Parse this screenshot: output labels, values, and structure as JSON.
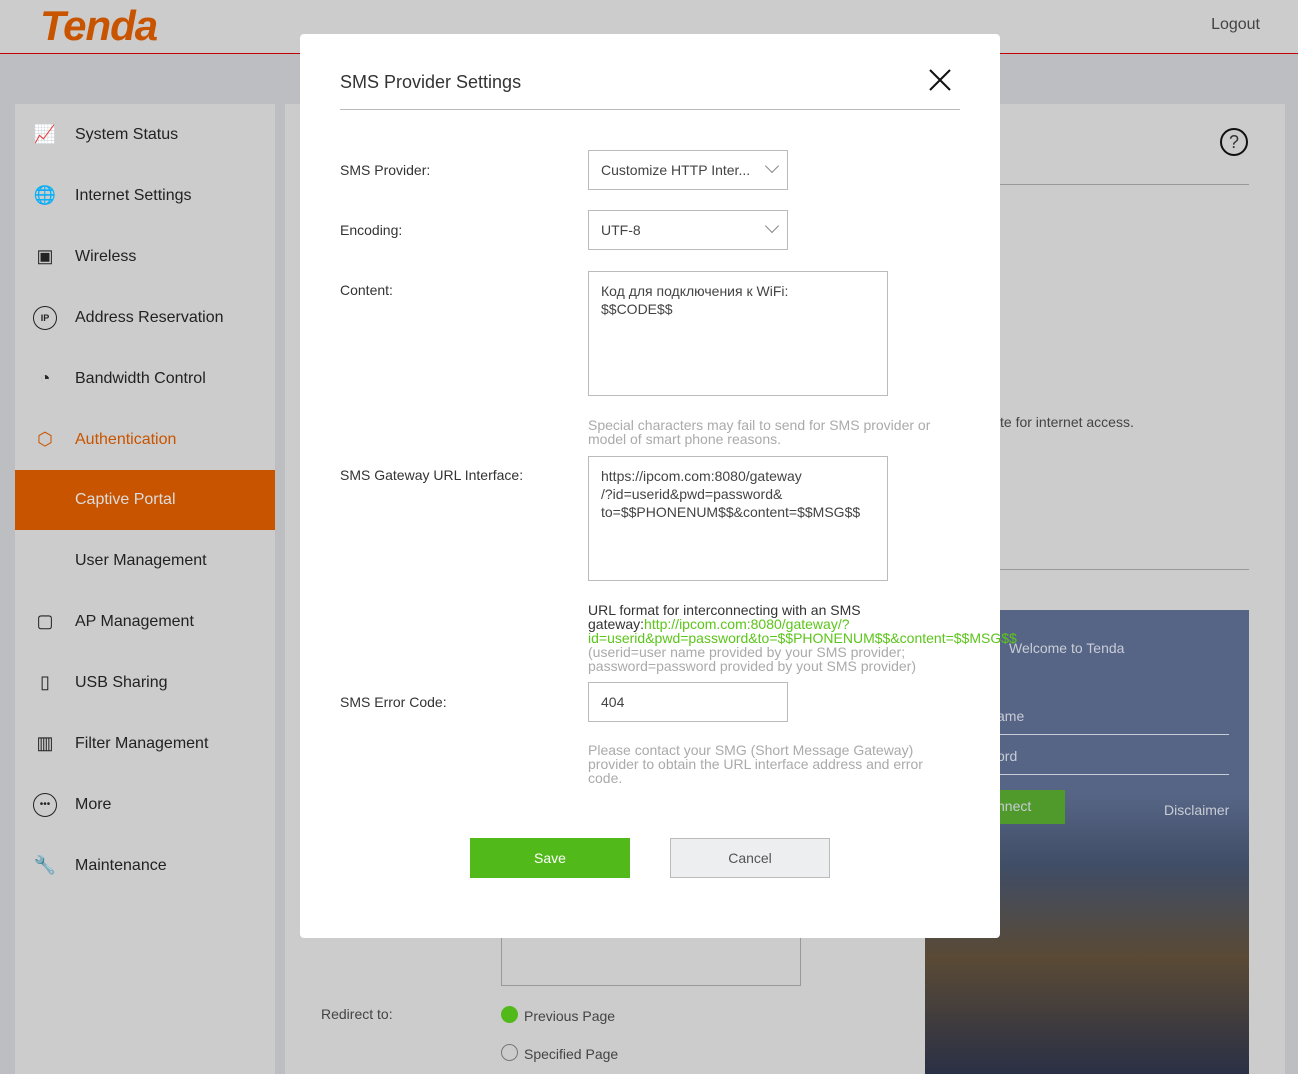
{
  "header": {
    "logo": "Tenda",
    "logout": "Logout"
  },
  "sidebar": {
    "items": [
      {
        "label": "System Status",
        "icon": "monitor-chart-icon"
      },
      {
        "label": "Internet Settings",
        "icon": "globe-icon"
      },
      {
        "label": "Wireless",
        "icon": "wifi-screen-icon"
      },
      {
        "label": "Address Reservation",
        "icon": "ip-icon"
      },
      {
        "label": "Bandwidth Control",
        "icon": "gauge-icon"
      },
      {
        "label": "Authentication",
        "icon": "shield-check-icon"
      },
      {
        "label": "Captive Portal",
        "icon": ""
      },
      {
        "label": "User Management",
        "icon": ""
      },
      {
        "label": "AP Management",
        "icon": "ap-icon"
      },
      {
        "label": "USB Sharing",
        "icon": "usb-icon"
      },
      {
        "label": "Filter Management",
        "icon": "filter-icon"
      },
      {
        "label": "More",
        "icon": "more-icon"
      },
      {
        "label": "Maintenance",
        "icon": "wrench-icon"
      }
    ]
  },
  "background": {
    "internet_text": "te for internet access.",
    "redirect_label": "Redirect to:",
    "previous_page": "Previous Page",
    "specified_page": "Specified Page",
    "preview": {
      "welcome": "Welcome to Tenda",
      "username": "ame",
      "password": "ord",
      "connect": "nnect",
      "disclaimer": "Disclaimer"
    }
  },
  "modal": {
    "title": "SMS Provider Settings",
    "provider_label": "SMS Provider:",
    "provider_value": "Customize HTTP Inter...",
    "encoding_label": "Encoding:",
    "encoding_value": "UTF-8",
    "content_label": "Content:",
    "content_value": "Код для подключения к WiFi:\n$$CODE$$",
    "content_hint": "Special characters may fail to send for SMS provider or model of smart phone reasons.",
    "url_label": "SMS Gateway URL Interface:",
    "url_value": "https://ipcom.com:8080/gateway\n/?id=userid&pwd=password&\nto=$$PHONENUM$$&content=$$MSG$$",
    "url_hint_prefix": "URL format for interconnecting with an SMS gateway:",
    "url_hint_example": "http://ipcom.com:8080/gateway/?id=userid&pwd=password&to=$$PHONENUM$$&content=$$MSG$$",
    "url_hint_suffix": "(userid=user name provided by your SMS provider; password=password provided by yout SMS provider)",
    "error_label": "SMS Error Code:",
    "error_value": "404",
    "error_hint": "Please contact your SMG (Short Message Gateway) provider to obtain the URL interface address and error code.",
    "save": "Save",
    "cancel": "Cancel"
  },
  "colors": {
    "brand": "#c85400",
    "save": "#52b91b",
    "link": "#5cc51a"
  }
}
